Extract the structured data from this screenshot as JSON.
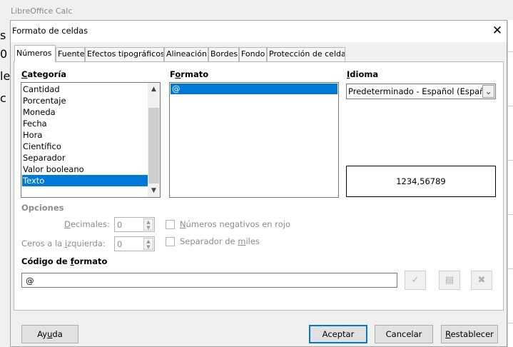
{
  "background": {
    "app_title": "LibreOffice Calc",
    "fragments": [
      "s",
      "0",
      "le",
      "c"
    ]
  },
  "dialog": {
    "title": "Formato de celdas",
    "close_glyph": "✕"
  },
  "tabs": [
    {
      "label": "Números",
      "active": true
    },
    {
      "label": "Fuente",
      "active": false
    },
    {
      "label": "Efectos tipográficos",
      "active": false
    },
    {
      "label": "Alineación",
      "active": false
    },
    {
      "label": "Bordes",
      "active": false
    },
    {
      "label": "Fondo",
      "active": false
    },
    {
      "label": "Protección de celda",
      "active": false
    }
  ],
  "categoria": {
    "label_pre": "",
    "label_ul": "C",
    "label_post": "ategoría",
    "items": [
      "Cantidad",
      "Porcentaje",
      "Moneda",
      "Fecha",
      "Hora",
      "Científico",
      "Separador",
      "Valor booleano",
      "Texto"
    ],
    "selected": "Texto"
  },
  "formato": {
    "label_pre": "F",
    "label_ul": "o",
    "label_post": "rmato",
    "items": [
      "@"
    ],
    "selected": "@"
  },
  "idioma": {
    "label_pre": "",
    "label_ul": "I",
    "label_post": "dioma",
    "value": "Predeterminado - Español (España)"
  },
  "preview": "1234,56789",
  "opciones": {
    "title": "Opciones",
    "decimales_pre": "",
    "decimales_ul": "D",
    "decimales_post": "ecimales:",
    "decimales_value": "0",
    "ceros_pre": "Ceros a la ",
    "ceros_ul": "i",
    "ceros_post": "zquierda:",
    "ceros_value": "0",
    "negativos_pre": "",
    "negativos_ul": "N",
    "negativos_post": "úmeros negativos en rojo",
    "separador_pre": "Separador de ",
    "separador_ul": "m",
    "separador_post": "iles"
  },
  "codigo": {
    "label_pre": "Código de ",
    "label_ul": "f",
    "label_post": "ormato",
    "value": "@"
  },
  "buttons": {
    "ayuda_pre": "Ay",
    "ayuda_ul": "u",
    "ayuda_post": "da",
    "aceptar": "Aceptar",
    "cancelar": "Cancelar",
    "restablecer_pre": "",
    "restablecer_ul": "R",
    "restablecer_post": "establecer"
  },
  "icons": {
    "check": "check-icon",
    "comment": "comment-icon",
    "delete": "delete-icon"
  },
  "colors": {
    "selection": "#0078d7",
    "dialog_bg": "#f0f0f0"
  }
}
